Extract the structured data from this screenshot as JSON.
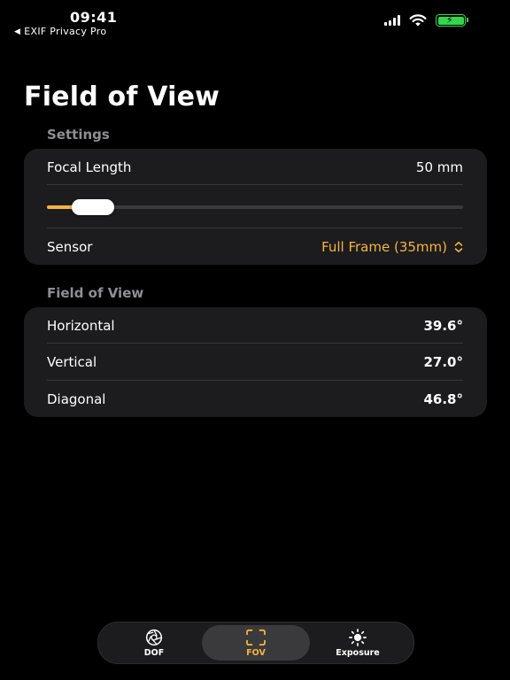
{
  "status": {
    "time": "09:41",
    "back_app": "EXIF Privacy Pro"
  },
  "page": {
    "title": "Field of View"
  },
  "settings": {
    "section_label": "Settings",
    "focal_length_label": "Focal Length",
    "focal_length_value": "50 mm",
    "focal_slider_fraction": 0.11,
    "sensor_label": "Sensor",
    "sensor_value": "Full Frame (35mm)"
  },
  "fov": {
    "section_label": "Field of View",
    "rows": [
      {
        "label": "Horizontal",
        "value": "39.6°"
      },
      {
        "label": "Vertical",
        "value": "27.0°"
      },
      {
        "label": "Diagonal",
        "value": "46.8°"
      }
    ]
  },
  "tabs": [
    {
      "label": "DOF",
      "icon": "aperture-icon",
      "active": false
    },
    {
      "label": "FOV",
      "icon": "viewfinder-icon",
      "active": true
    },
    {
      "label": "Exposure",
      "icon": "sun-icon",
      "active": false
    }
  ],
  "colors": {
    "accent": "#f4b43d",
    "background": "#000000",
    "card": "#1c1c1e",
    "secondary_text": "#8e8e93",
    "battery": "#32d74b"
  }
}
